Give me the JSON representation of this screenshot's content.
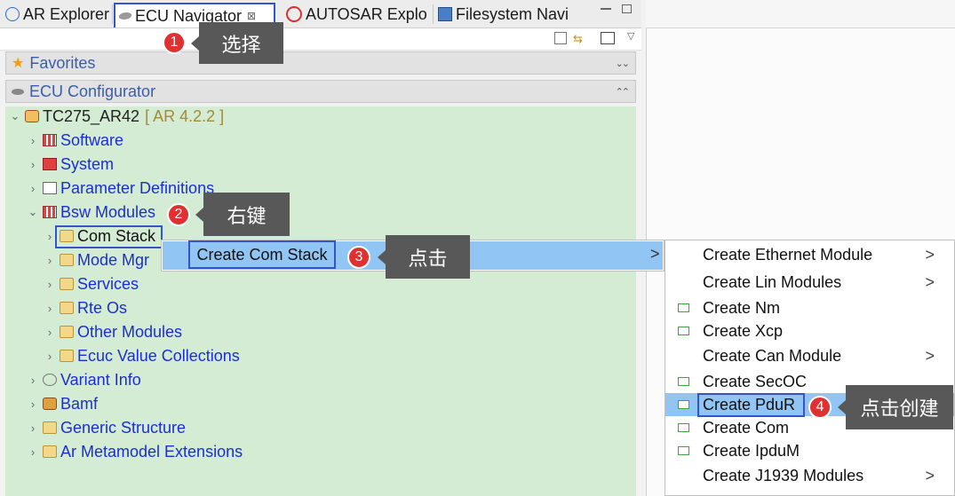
{
  "tabs": [
    {
      "label": "AR Explorer"
    },
    {
      "label": "ECU Navigator",
      "close": "⊠"
    },
    {
      "label": "AUTOSAR Explo"
    },
    {
      "label": "Filesystem Navi"
    }
  ],
  "sections": {
    "favorites": "Favorites",
    "ecu_configurator": "ECU Configurator"
  },
  "tree": {
    "root": {
      "label": "TC275_AR42",
      "version": "[ AR 4.2.2 ]"
    },
    "items": [
      {
        "label": "Software"
      },
      {
        "label": "System"
      },
      {
        "label": "Parameter Definitions"
      },
      {
        "label": "Bsw Modules"
      },
      {
        "label": "Com Stack"
      },
      {
        "label": "Mode Mgr"
      },
      {
        "label": "Services"
      },
      {
        "label": "Rte Os"
      },
      {
        "label": "Other Modules"
      },
      {
        "label": "Ecuc Value Collections"
      },
      {
        "label": "Variant Info"
      },
      {
        "label": "Bamf"
      },
      {
        "label": "Generic Structure"
      },
      {
        "label": "Ar Metamodel Extensions"
      }
    ]
  },
  "context_menu": {
    "item": "Create Com Stack",
    "arrow": ">"
  },
  "submenu": {
    "items": [
      {
        "label": "Create Ethernet Module",
        "arrow": ">"
      },
      {
        "label": "Create Lin Modules",
        "arrow": ">"
      },
      {
        "label": "Create Nm"
      },
      {
        "label": "Create Xcp"
      },
      {
        "label": "Create Can Module",
        "arrow": ">"
      },
      {
        "label": "Create SecOC"
      },
      {
        "label": "Create PduR"
      },
      {
        "label": "Create Com"
      },
      {
        "label": "Create IpduM"
      },
      {
        "label": "Create J1939 Modules",
        "arrow": ">"
      }
    ]
  },
  "callouts": [
    {
      "number": "1",
      "text": "选择"
    },
    {
      "number": "2",
      "text": "右键"
    },
    {
      "number": "3",
      "text": "点击"
    },
    {
      "number": "4",
      "text": "点击创建"
    }
  ],
  "colors": {
    "highlight": "#91c5f3",
    "tree_bg": "#d4ebd4",
    "link_blue": "#1b2fd0",
    "callout_red": "#e03030",
    "tooltip_gray": "#585858",
    "focus_border": "#3355cc"
  }
}
